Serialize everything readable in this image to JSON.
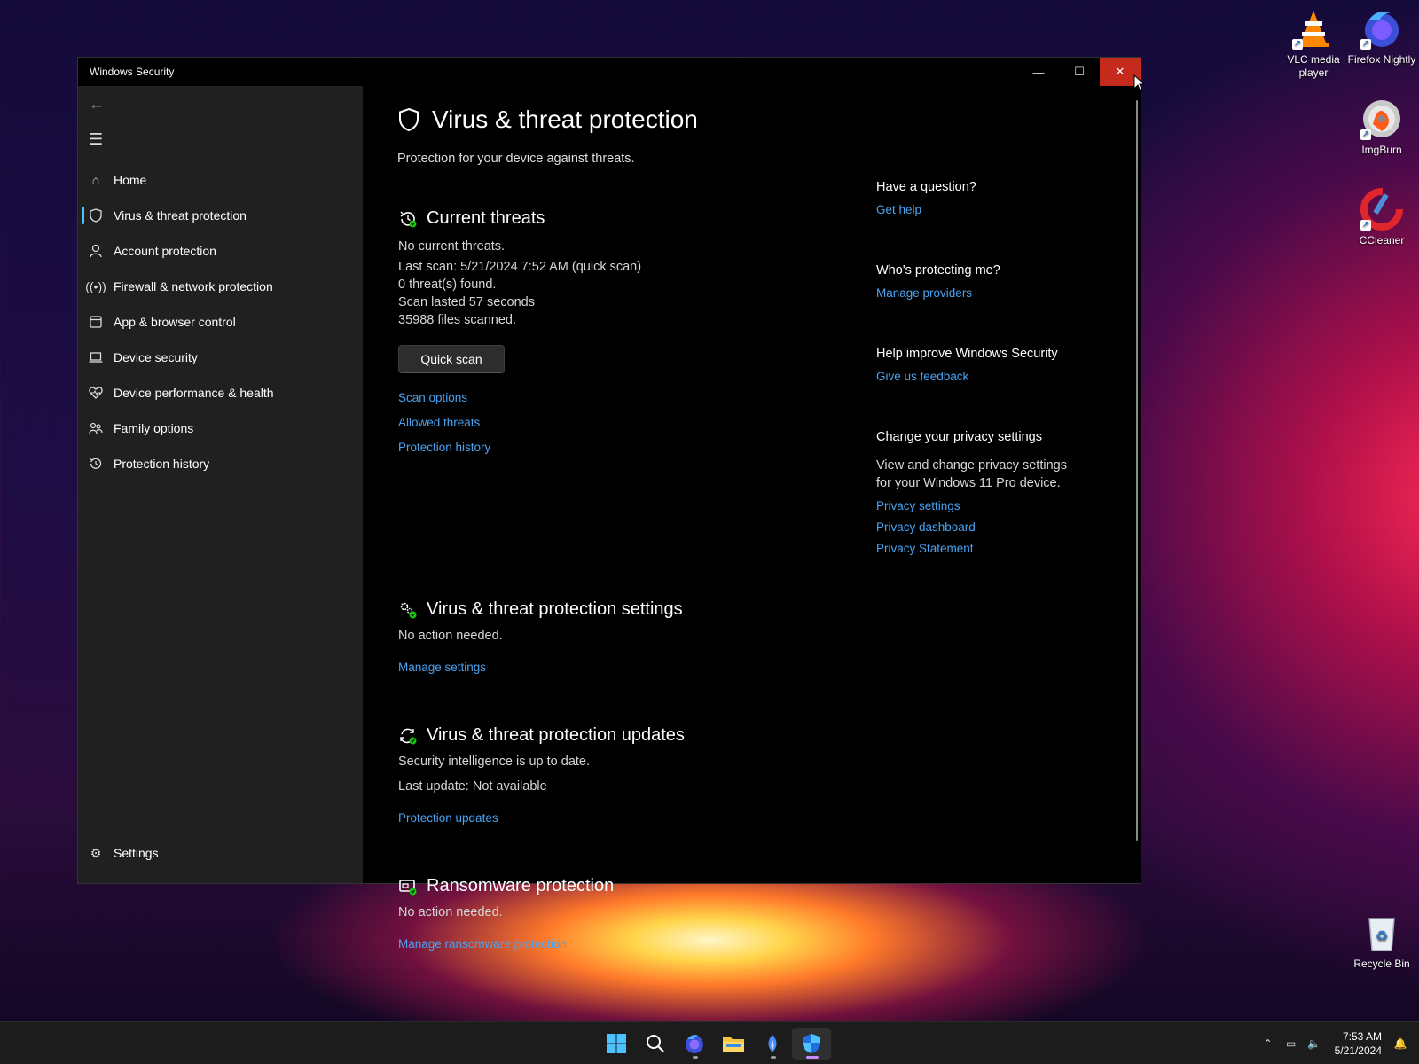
{
  "desktop": {
    "icons": [
      {
        "label": "VLC media player"
      },
      {
        "label": "Firefox Nightly"
      },
      {
        "label": "ImgBurn"
      },
      {
        "label": "CCleaner"
      },
      {
        "label": "Recycle Bin"
      }
    ]
  },
  "window": {
    "title": "Windows Security",
    "controls": {
      "minimize": "—",
      "maximize": "☐",
      "close": "✕"
    }
  },
  "sidebar": {
    "items": [
      {
        "label": "Home"
      },
      {
        "label": "Virus & threat protection"
      },
      {
        "label": "Account protection"
      },
      {
        "label": "Firewall & network protection"
      },
      {
        "label": "App & browser control"
      },
      {
        "label": "Device security"
      },
      {
        "label": "Device performance & health"
      },
      {
        "label": "Family options"
      },
      {
        "label": "Protection history"
      }
    ],
    "settings": "Settings"
  },
  "main": {
    "title": "Virus & threat protection",
    "subtitle": "Protection for your device against threats.",
    "current_threats": {
      "heading": "Current threats",
      "lines": [
        "No current threats.",
        "Last scan: 5/21/2024 7:52 AM (quick scan)",
        "0 threat(s) found.",
        "Scan lasted 57 seconds",
        "35988 files scanned."
      ],
      "button": "Quick scan",
      "links": [
        "Scan options",
        "Allowed threats",
        "Protection history"
      ]
    },
    "settings_section": {
      "heading": "Virus & threat protection settings",
      "status": "No action needed.",
      "link": "Manage settings"
    },
    "updates_section": {
      "heading": "Virus & threat protection updates",
      "status": "Security intelligence is up to date.",
      "last_update": "Last update: Not available",
      "link": "Protection updates"
    },
    "ransomware_section": {
      "heading": "Ransomware protection",
      "status": "No action needed.",
      "link": "Manage ransomware protection"
    }
  },
  "side_panel": {
    "question": {
      "heading": "Have a question?",
      "link": "Get help"
    },
    "protecting": {
      "heading": "Who's protecting me?",
      "link": "Manage providers"
    },
    "improve": {
      "heading": "Help improve Windows Security",
      "link": "Give us feedback"
    },
    "privacy": {
      "heading": "Change your privacy settings",
      "text": "View and change privacy settings for your Windows 11 Pro device.",
      "links": [
        "Privacy settings",
        "Privacy dashboard",
        "Privacy Statement"
      ]
    }
  },
  "taskbar": {
    "apps": [
      "start-icon",
      "search-icon",
      "firefox-nightly-icon",
      "file-explorer-icon",
      "app-icon",
      "windows-security-icon"
    ],
    "time": "7:53 AM",
    "date": "5/21/2024"
  },
  "colors": {
    "accent": "#4cc2ff",
    "link": "#4aa3f0",
    "close": "#c42b1c"
  }
}
